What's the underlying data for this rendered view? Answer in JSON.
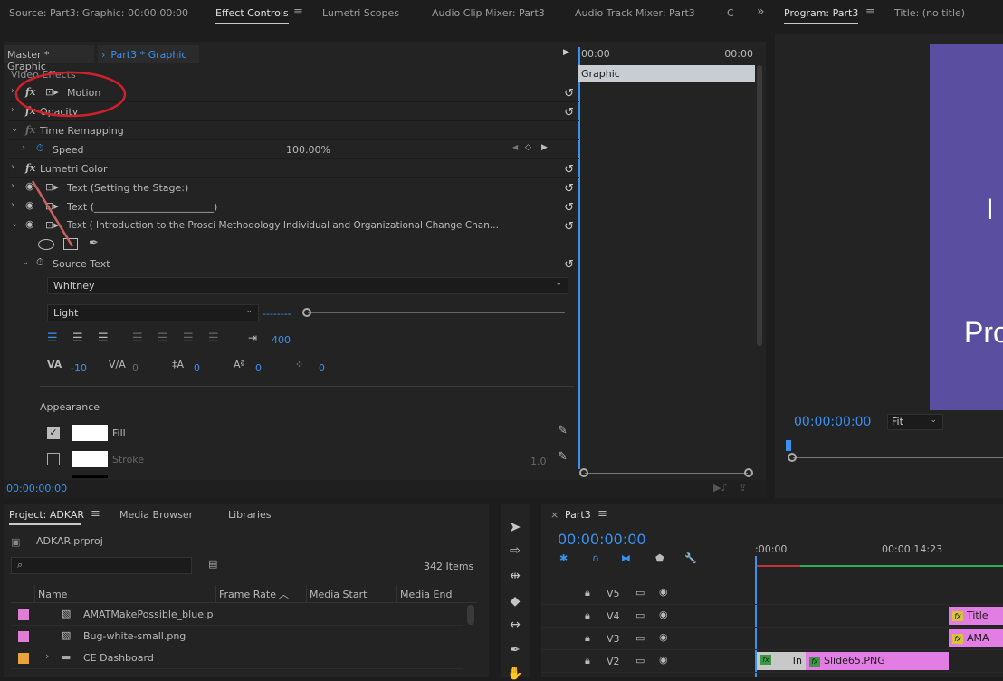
{
  "top_tabs": {
    "source": "Source: Part3: Graphic: 00:00:00:00",
    "effect_controls": "Effect Controls",
    "lumetri_scopes": "Lumetri Scopes",
    "audio_clip_mixer": "Audio Clip Mixer: Part3",
    "audio_track_mixer": "Audio Track Mixer: Part3",
    "overflow": "C",
    "more": "»",
    "menu_icon": "≡"
  },
  "program_tabs": {
    "program": "Program: Part3",
    "title": "Title: (no title)"
  },
  "effect_controls": {
    "master_tab": "Master * Graphic",
    "sequence_tab": "Part3 * Graphic",
    "video_effects_label": "Video Effects",
    "mini_timeline_start": "00:00",
    "mini_timeline_end": "00:00",
    "clip_label": "Graphic",
    "effects": [
      {
        "name": "Motion"
      },
      {
        "name": "Opacity"
      },
      {
        "name": "Time Remapping"
      },
      {
        "name": "Lumetri Color"
      },
      {
        "name": "Text (Setting the Stage:)"
      },
      {
        "name": "Text (________________________)"
      },
      {
        "name": "Text (  Introduction to the Prosci Methodology      Individual and Organizational Change       Chan..."
      }
    ],
    "speed_label": "Speed",
    "speed_value": "100.00%",
    "source_text_label": "Source Text",
    "font_family": "Whitney",
    "font_style": "Light",
    "font_size_placeholder": "--------",
    "tab_width": "400",
    "tracking": "-10",
    "kerning": "0",
    "leading": "0",
    "baseline": "0",
    "tsume": "0",
    "appearance_label": "Appearance",
    "fill_label": "Fill",
    "fill_checked": true,
    "stroke_label": "Stroke",
    "stroke_checked": false,
    "stroke_width": "1.0",
    "timecode": "00:00:00:00"
  },
  "program_monitor": {
    "timecode": "00:00:00:00",
    "zoom": "Fit",
    "preview_text_1": "I",
    "preview_text_2": "Pro",
    "preview_color": "#5a4ea1"
  },
  "project": {
    "tabs": [
      "Project: ADKAR",
      "Media Browser",
      "Libraries"
    ],
    "file_name": "ADKAR.prproj",
    "item_count": "342 Items",
    "columns": [
      "Name",
      "Frame Rate",
      "Media Start",
      "Media End"
    ],
    "items": [
      {
        "name": "AMATMakePossible_blue.p",
        "color": "#e07ed4",
        "type": "image"
      },
      {
        "name": "Bug-white-small.png",
        "color": "#e07ed4",
        "type": "image"
      },
      {
        "name": "CE Dashboard",
        "color": "#e8a33c",
        "type": "folder"
      }
    ]
  },
  "timeline": {
    "sequence_name": "Part3",
    "timecode": "00:00:00:00",
    "ruler_start": ":00:00",
    "ruler_mark": "00:00:14:23",
    "tracks": [
      {
        "name": "V5",
        "clips": []
      },
      {
        "name": "V4",
        "clips": [
          {
            "label": "Title"
          }
        ]
      },
      {
        "name": "V3",
        "clips": [
          {
            "label": "AMA"
          }
        ]
      },
      {
        "name": "V2",
        "clips": [
          {
            "label": "In"
          },
          {
            "label": "Slide65.PNG"
          }
        ]
      }
    ]
  },
  "colors": {
    "accent_blue": "#3b91f0",
    "clip_pink": "#e27de3",
    "annotation_red": "#d0202a"
  }
}
